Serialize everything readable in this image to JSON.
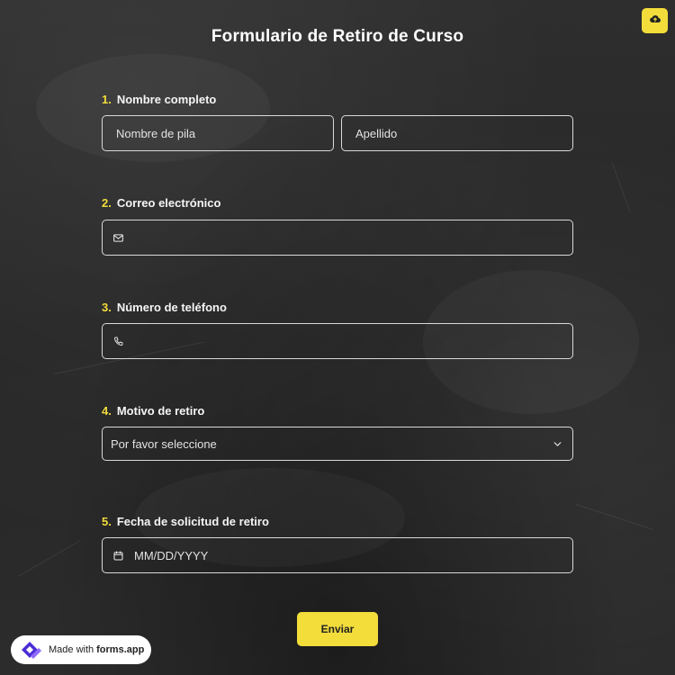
{
  "form": {
    "title": "Formulario de Retiro de Curso",
    "questions": [
      {
        "number": "1.",
        "label": "Nombre completo",
        "first_name_placeholder": "Nombre de pila",
        "last_name_placeholder": "Apellido"
      },
      {
        "number": "2.",
        "label": "Correo electrónico",
        "icon": "mail-icon",
        "value": ""
      },
      {
        "number": "3.",
        "label": "Número de teléfono",
        "icon": "phone-icon",
        "value": ""
      },
      {
        "number": "4.",
        "label": "Motivo de retiro",
        "selected": "Por favor seleccione",
        "icon": "chevron-down-icon"
      },
      {
        "number": "5.",
        "label": "Fecha de solicitud de retiro",
        "icon": "calendar-icon",
        "placeholder": "MM/DD/YYYY"
      }
    ],
    "submit_label": "Enviar"
  },
  "top_action": {
    "icon": "cloud-upload-icon"
  },
  "badge": {
    "prefix": "Made with",
    "brand": "forms.app"
  },
  "colors": {
    "accent": "#f2dd3b",
    "background": "#2b2b2b",
    "border": "#d9d9d9"
  }
}
